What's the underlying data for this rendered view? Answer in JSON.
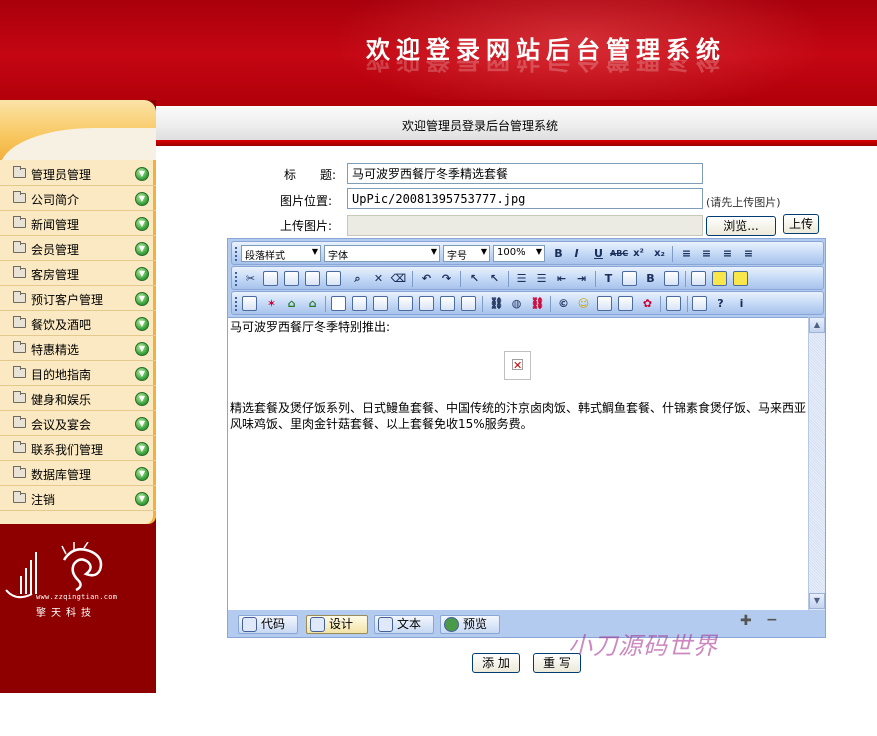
{
  "header": {
    "site_title": "欢迎登录网站后台管理系统"
  },
  "welcome": {
    "text": "欢迎管理员登录后台管理系统"
  },
  "sidebar": {
    "items": [
      {
        "label": "管理员管理"
      },
      {
        "label": "公司简介"
      },
      {
        "label": "新闻管理"
      },
      {
        "label": "会员管理"
      },
      {
        "label": "客房管理"
      },
      {
        "label": "预订客户管理"
      },
      {
        "label": "餐饮及酒吧"
      },
      {
        "label": "特惠精选"
      },
      {
        "label": "目的地指南"
      },
      {
        "label": "健身和娱乐"
      },
      {
        "label": "会议及宴会"
      },
      {
        "label": "联系我们管理"
      },
      {
        "label": "数据库管理"
      },
      {
        "label": "注销"
      }
    ],
    "arrow_icon": "chevron-down-icon"
  },
  "logo": {
    "url": "www.zzqingtian.com",
    "name": "擎天科技"
  },
  "form": {
    "title_label": "标　　题:",
    "title_value": "马可波罗西餐厅冬季精选套餐",
    "pic_label": "图片位置:",
    "pic_value": "UpPic/20081395753777.jpg",
    "pic_hint": "(请先上传图片)",
    "upload_label": "上传图片:",
    "browse_label": "浏览...",
    "upload_button": "上传"
  },
  "editor": {
    "toolbar": {
      "paragraph_style": "段落样式",
      "font": "字体",
      "size": "字号",
      "zoom": "100%"
    },
    "content": {
      "line1": "马可波罗西餐厅冬季特别推出:",
      "body": "精选套餐及煲仔饭系列、日式鳗鱼套餐、中国传统的汴京卤肉饭、韩式鲷鱼套餐、什锦素食煲仔饭、马来西亚风味鸡饭、里肉金针菇套餐、以上套餐免收15%服务费。"
    },
    "tabs": [
      {
        "label": "代码"
      },
      {
        "label": "设计"
      },
      {
        "label": "文本"
      },
      {
        "label": "预览"
      }
    ],
    "active_tab": "设计"
  },
  "buttons": {
    "submit": "添 加",
    "reset": "重 写"
  },
  "watermark": "小刀源码世界",
  "colors": {
    "header_red": "#c40612",
    "sidebar_bg": "#fae9c2",
    "left_col": "#8e0000",
    "editor_blue": "#b3cbee"
  }
}
